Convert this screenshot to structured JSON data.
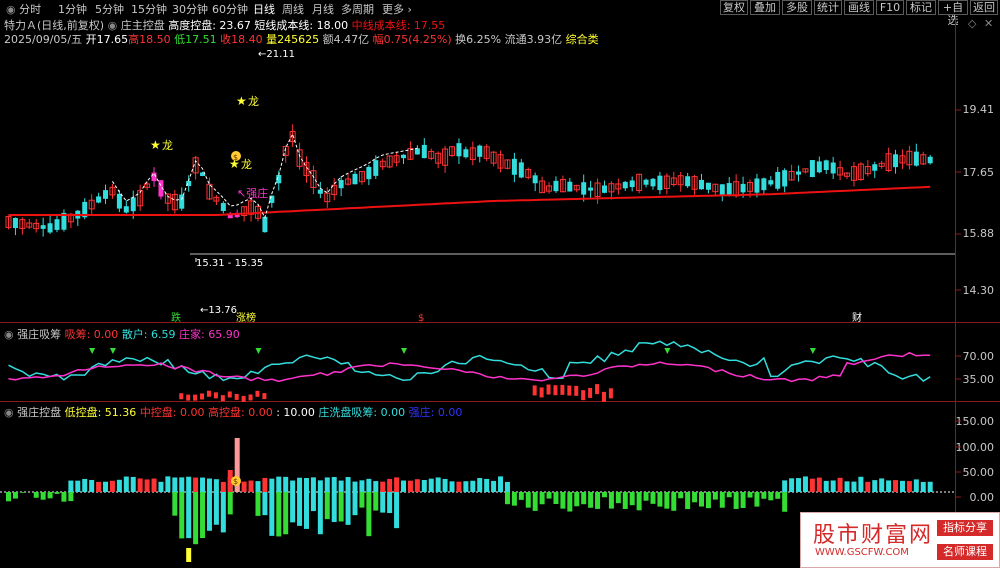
{
  "toolbar": {
    "tabs": [
      "分时",
      "1分钟",
      "5分钟",
      "15分钟",
      "30分钟",
      "60分钟",
      "日线",
      "周线",
      "月线",
      "多周期",
      "更多 ›"
    ],
    "active_tab": "日线",
    "buttons": [
      "复权",
      "叠加",
      "多股",
      "统计",
      "画线",
      "F10",
      "标记",
      "+自选",
      "返回"
    ]
  },
  "main_panel": {
    "stock_name": "特力Ａ(日线,前复权)",
    "indicator_name": "庄主控盘",
    "indicator_high_label": "高度控盘: 23.67",
    "short_cost_label": "短线成本线: 18.00",
    "mid_cost_label": "中线成本线: 17.55",
    "date": "2025/09/05/五",
    "open": "开17.65",
    "high": "高18.50",
    "low": "低17.51",
    "close": "收18.40",
    "volume": "量245625",
    "amount": "额4.47亿",
    "change": "幅0.75(4.25%)",
    "turnover": "换6.25%",
    "float": "流通3.93亿",
    "sector": "综合类",
    "price_axis": [
      "19.41",
      "17.65",
      "15.88",
      "14.30"
    ],
    "annotations": {
      "high_price": "21.11",
      "low_range": "15.31 - 15.35",
      "low_price": "13.76",
      "dragon1": "龙",
      "dragon2": "龙",
      "dragon3": "龙",
      "strong": "强庄",
      "dollar": "$"
    },
    "markers": {
      "die": "跌",
      "zhangbang": "涨榜",
      "dollar": "$",
      "cai": "财"
    }
  },
  "panel2": {
    "name": "强庄吸筹",
    "xichou": "吸筹: 0.00",
    "sanhu": "散户: 6.59",
    "zhuangjia": "庄家: 65.90",
    "axis": [
      "70.00",
      "35.00"
    ]
  },
  "panel3": {
    "name": "强庄控盘",
    "low_ctrl": "低控盘: 51.36",
    "mid_ctrl": "中控盘: 0.00",
    "high_ctrl": "高控盘: 0.00",
    "ten": ": 10.00",
    "wash": "庄洗盘吸筹: 0.00",
    "strong": "强庄: 0.00",
    "axis": [
      "150.00",
      "100.00",
      "50.00",
      "0.00"
    ]
  },
  "logo": {
    "name": "股市财富网",
    "url": "WWW.GSCFW.COM",
    "tag1": "指标分享",
    "tag2": "名师课程"
  },
  "colors": {
    "up": "#ff3333",
    "down": "#33cccc",
    "magenta": "#ff33cc",
    "red_line": "#ee1111",
    "yellow": "#ffff33",
    "green": "#33dd33",
    "cyan_bar": "#33dddd",
    "blue": "#3333ff"
  }
}
